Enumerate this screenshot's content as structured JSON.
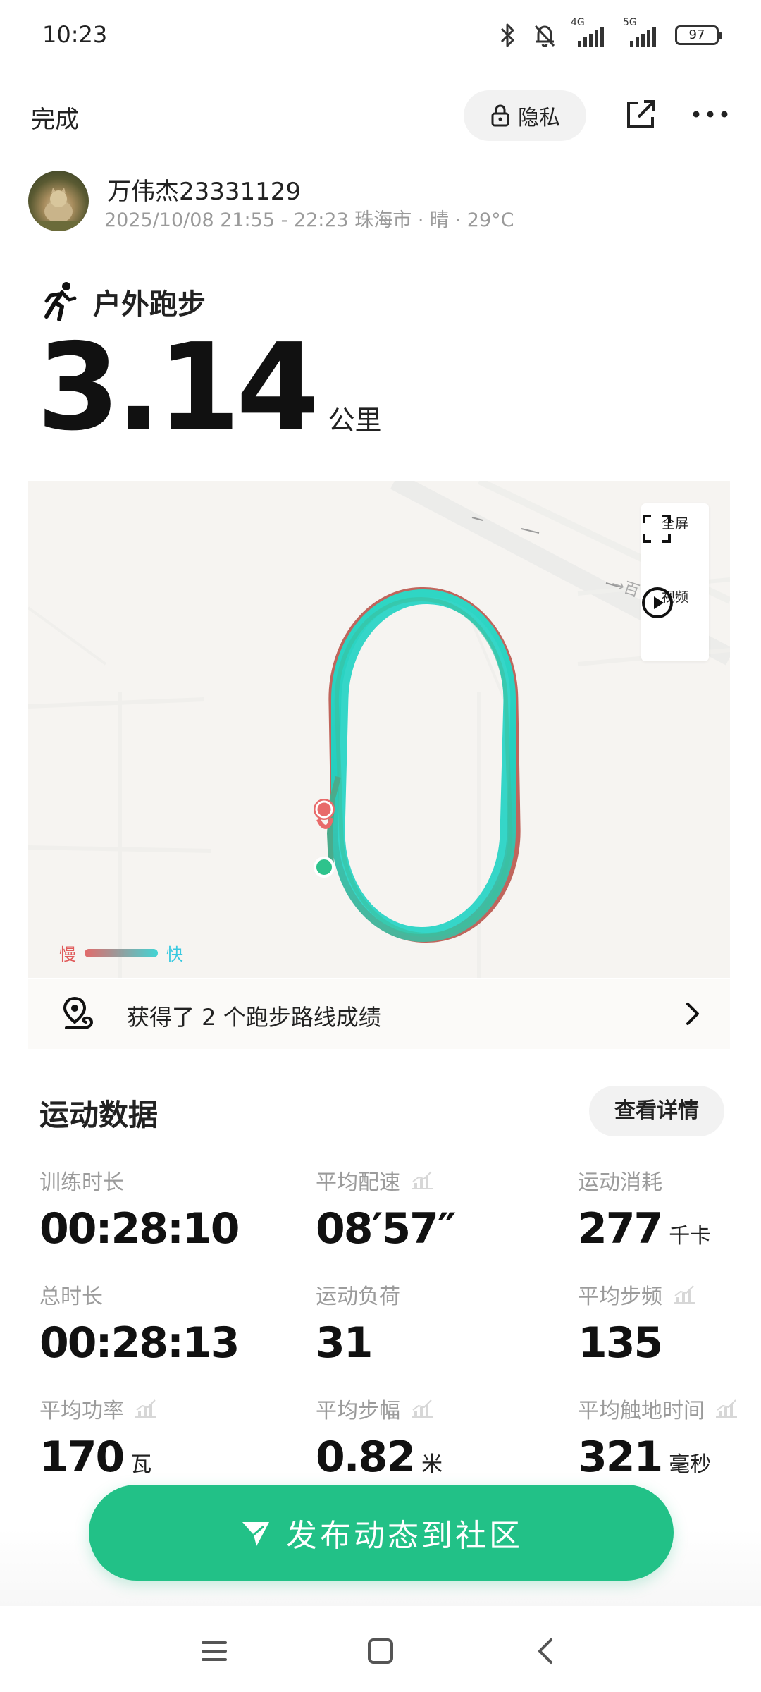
{
  "status_bar": {
    "time": "10:23",
    "network1": "4G",
    "network2": "5G",
    "battery": "97"
  },
  "topbar": {
    "done": "完成",
    "privacy": "隐私"
  },
  "user": {
    "name": "万伟杰23331129",
    "subinfo": "2025/10/08 21:55 - 22:23 珠海市 · 晴 · 29°C"
  },
  "sport": {
    "type": "户外跑步",
    "distance": "3.14",
    "unit": "公里"
  },
  "map": {
    "fullscreen": "全屏",
    "video": "视频",
    "street": "→百",
    "legend_slow": "慢",
    "legend_fast": "快",
    "colors": {
      "slow": "#e05a5a",
      "fast": "#3ac9e0"
    }
  },
  "achievement": {
    "text": "获得了 2 个跑步路线成绩"
  },
  "section": {
    "title": "运动数据",
    "detail_button": "查看详情"
  },
  "stats": [
    {
      "label": "训练时长",
      "value": "00:28:10",
      "unit": ""
    },
    {
      "label": "平均配速",
      "value": "08′57″",
      "unit": ""
    },
    {
      "label": "运动消耗",
      "value": "277",
      "unit": "千卡"
    },
    {
      "label": "总时长",
      "value": "00:28:13",
      "unit": ""
    },
    {
      "label": "运动负荷",
      "value": "31",
      "unit": ""
    },
    {
      "label": "平均步频",
      "value": "135",
      "unit": ""
    },
    {
      "label": "平均功率",
      "value": "170",
      "unit": "瓦"
    },
    {
      "label": "平均步幅",
      "value": "0.82",
      "unit": "米"
    },
    {
      "label": "平均触地时间",
      "value": "321",
      "unit": "毫秒"
    }
  ],
  "publish": {
    "label": "发布动态到社区",
    "color": "#22c187"
  }
}
